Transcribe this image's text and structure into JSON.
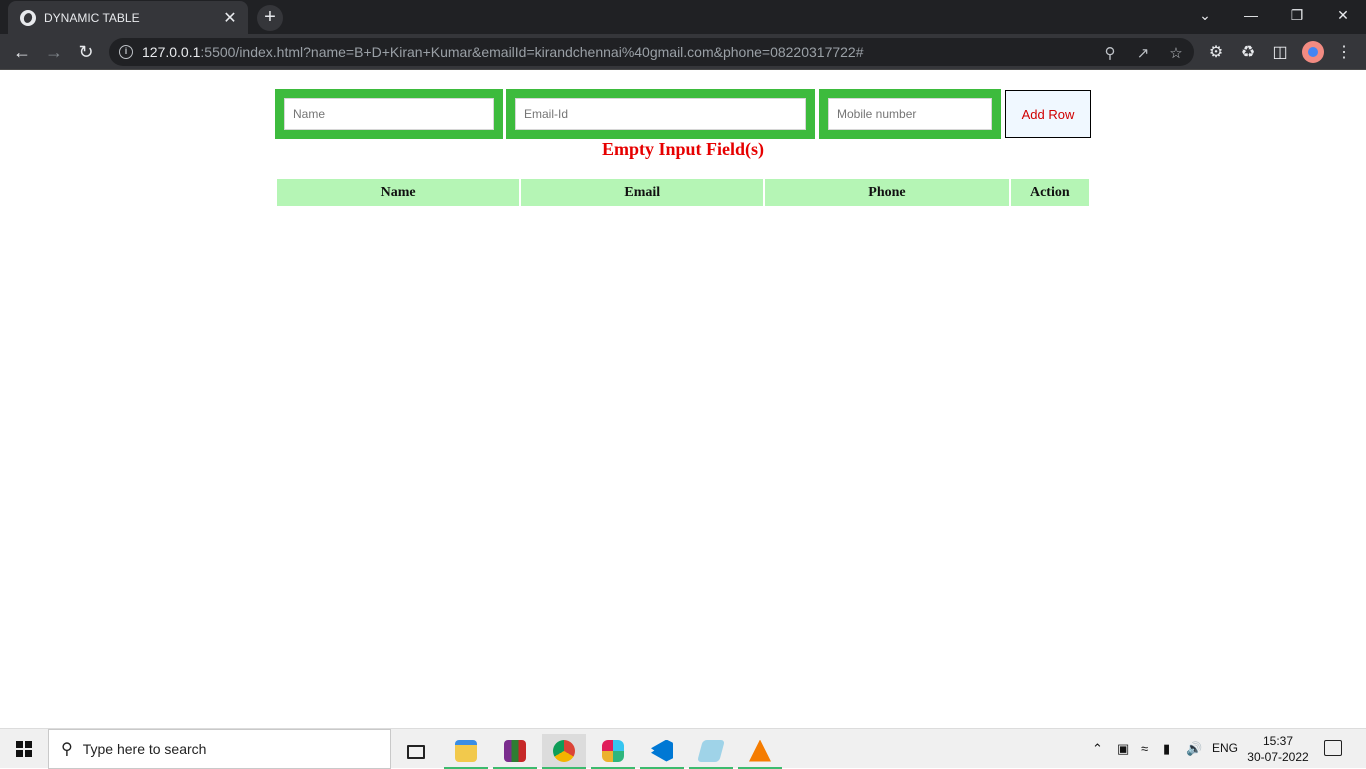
{
  "browser": {
    "tab": {
      "title": "DYNAMIC TABLE",
      "close_glyph": "✕"
    },
    "new_tab_glyph": "+",
    "window_controls": {
      "minimize": "—",
      "restore": "❐",
      "close": "✕",
      "tab_search": "⌄"
    },
    "nav": {
      "back": "←",
      "forward": "→",
      "reload": "↻"
    },
    "url": {
      "host": "127.0.0.1",
      "rest": ":5500/index.html?name=B+D+Kiran+Kumar&emailId=kirandchennai%40gmail.com&phone=08220317722#"
    }
  },
  "form": {
    "name_placeholder": "Name",
    "email_placeholder": "Email-Id",
    "phone_placeholder": "Mobile number",
    "add_button": "Add Row",
    "error_message": "Empty Input Field(s)"
  },
  "table": {
    "headers": [
      "Name",
      "Email",
      "Phone",
      "Action"
    ]
  },
  "taskbar": {
    "search_placeholder": "Type here to search",
    "apps": [
      "task-view",
      "file-explorer",
      "winrar",
      "chrome",
      "slack",
      "vscode",
      "notepad",
      "vlc"
    ],
    "language": "ENG",
    "time": "15:37",
    "date": "30-07-2022"
  },
  "colors": {
    "input_border_green": "#3dbb3d",
    "header_green": "#b5f5b5",
    "error_red": "#e60000",
    "button_text_red": "#d00000"
  }
}
